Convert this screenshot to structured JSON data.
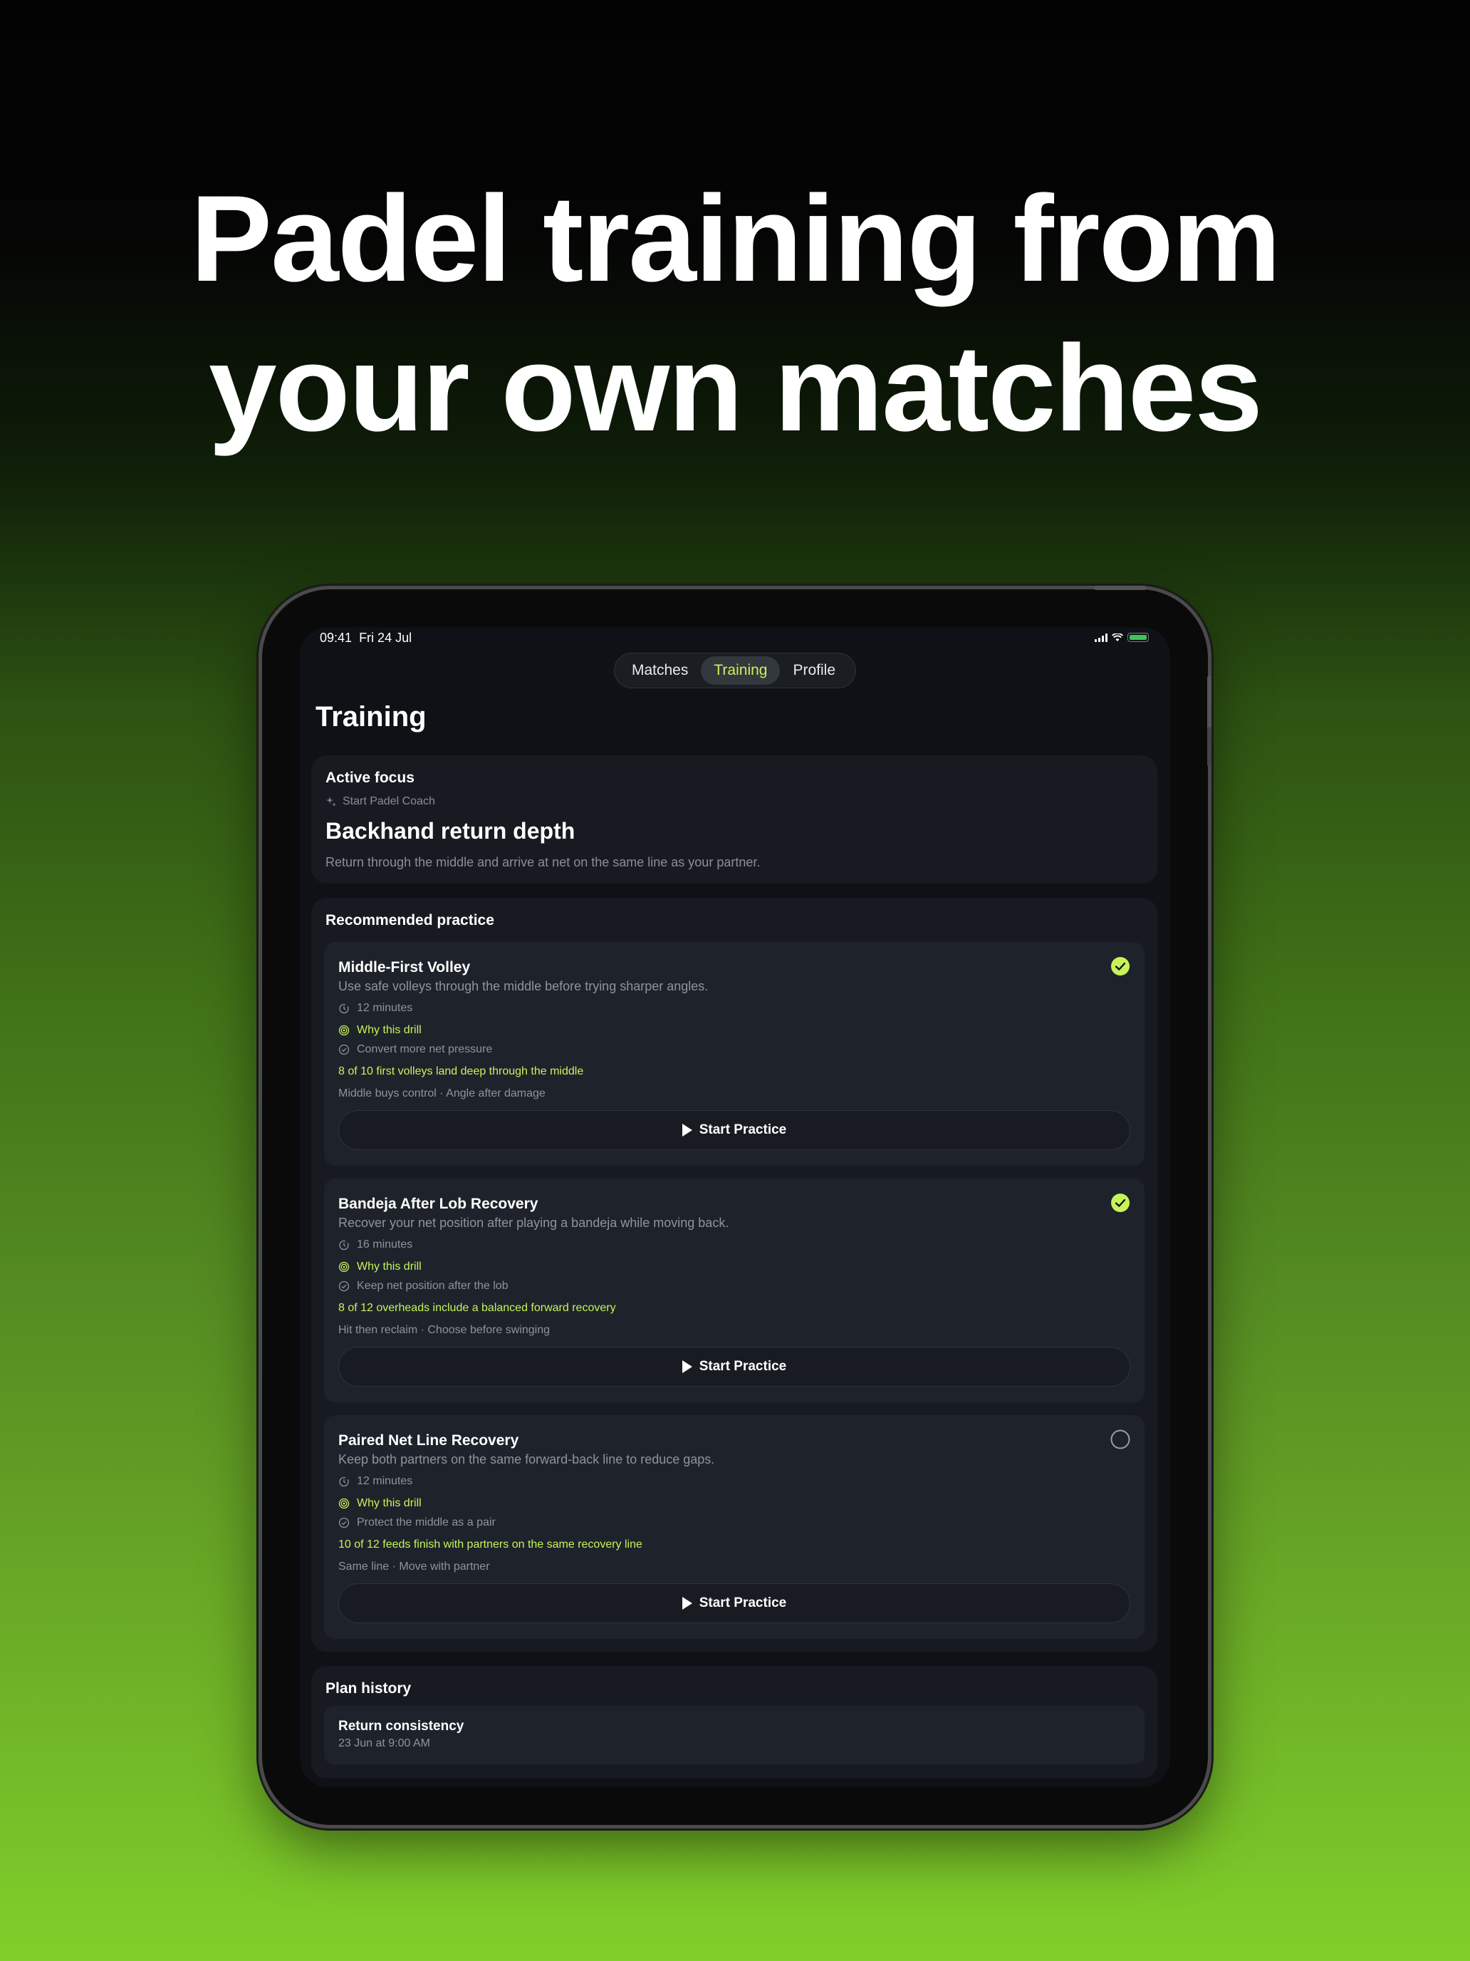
{
  "headline": {
    "line1": "Padel training from",
    "line2": "your own matches"
  },
  "status_bar": {
    "time": "09:41",
    "date": "Fri 24 Jul"
  },
  "tabs": [
    {
      "label": "Matches",
      "active": false
    },
    {
      "label": "Training",
      "active": true
    },
    {
      "label": "Profile",
      "active": false
    }
  ],
  "page_title": "Training",
  "active_focus": {
    "heading": "Active focus",
    "coach_link": "Start Padel Coach",
    "title": "Backhand return depth",
    "description": "Return through the middle and arrive at net on the same line as your partner."
  },
  "recommended": {
    "heading": "Recommended practice",
    "why_label": "Why this drill",
    "start_label": "Start Practice",
    "drills": [
      {
        "name": "Middle-First Volley",
        "description": "Use safe volleys through the middle before trying sharper angles.",
        "duration": "12 minutes",
        "reason": "Convert more net pressure",
        "goal": "8 of 10 first volleys land deep through the middle",
        "tags": "Middle buys control · Angle after damage",
        "completed": true
      },
      {
        "name": "Bandeja After Lob Recovery",
        "description": "Recover your net position after playing a bandeja while moving back.",
        "duration": "16 minutes",
        "reason": "Keep net position after the lob",
        "goal": "8 of 12 overheads include a balanced forward recovery",
        "tags": "Hit then reclaim · Choose before swinging",
        "completed": true
      },
      {
        "name": "Paired Net Line Recovery",
        "description": "Keep both partners on the same forward-back line to reduce gaps.",
        "duration": "12 minutes",
        "reason": "Protect the middle as a pair",
        "goal": "10 of 12 feeds finish with partners on the same recovery line",
        "tags": "Same line · Move with partner",
        "completed": false
      }
    ]
  },
  "plan_history": {
    "heading": "Plan history",
    "items": [
      {
        "name": "Return consistency",
        "date": "23 Jun at 9:00 AM"
      }
    ]
  },
  "colors": {
    "accent": "#c8f25a",
    "background_bottom": "#80cf2a",
    "card": "#171a20",
    "drill_card": "#1e232b"
  }
}
